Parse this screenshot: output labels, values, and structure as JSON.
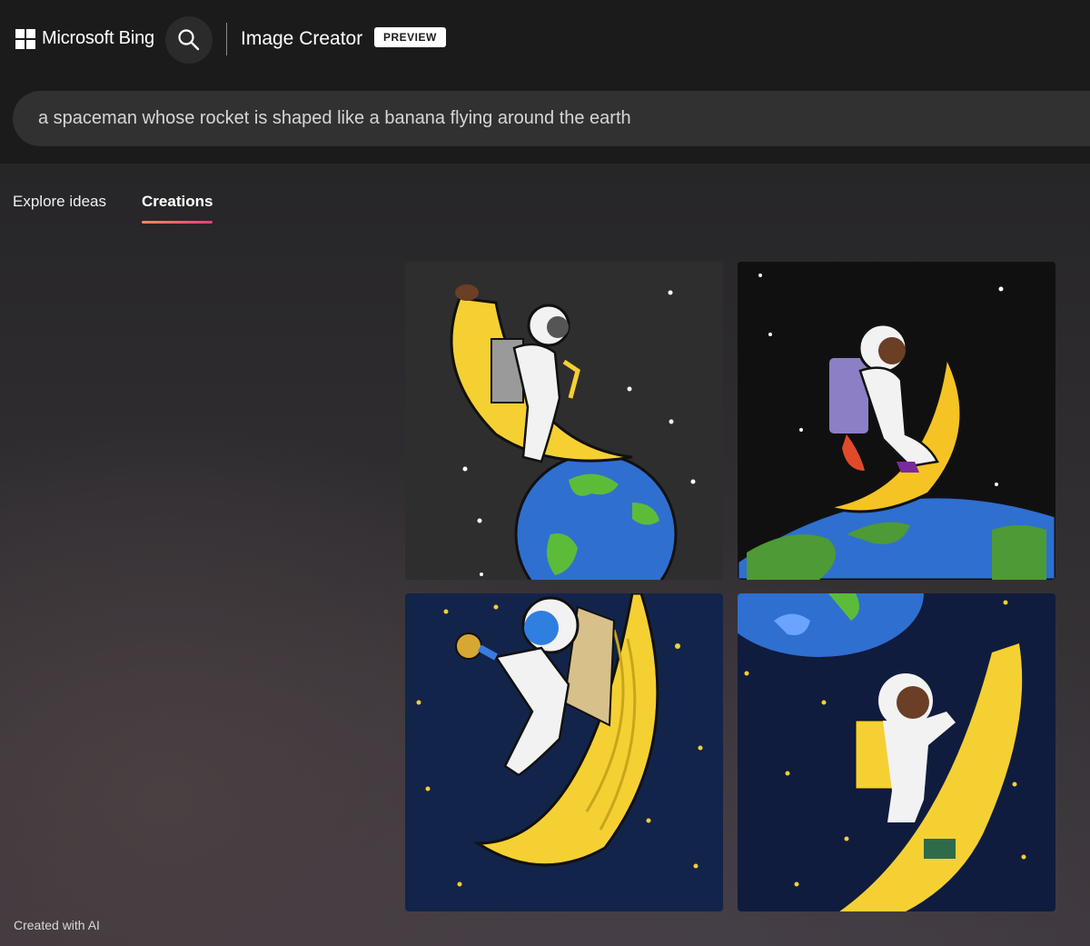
{
  "header": {
    "brand": "Microsoft Bing",
    "app_title": "Image Creator",
    "badge": "PREVIEW",
    "search_icon": "search-icon"
  },
  "prompt": {
    "value": "a spaceman whose rocket is shaped like a banana flying around the earth"
  },
  "tabs": [
    {
      "label": "Explore ideas",
      "active": false
    },
    {
      "label": "Creations",
      "active": true
    }
  ],
  "results": [
    {
      "description_icon": "generated-image-1",
      "background": "#2e2e2e"
    },
    {
      "description_icon": "generated-image-2",
      "background": "#101010"
    },
    {
      "description_icon": "generated-image-3",
      "background": "#13244a"
    },
    {
      "description_icon": "generated-image-4",
      "background": "#0f1c3e"
    }
  ],
  "footer": {
    "note": "Created with AI"
  },
  "colors": {
    "header_bg": "#1c1b1b",
    "tab_underline_start": "#f08a5d",
    "tab_underline_end": "#e0407a",
    "banana": "#f5d033",
    "earth_ocean": "#2f6fd0",
    "earth_land": "#5dbb3a"
  }
}
